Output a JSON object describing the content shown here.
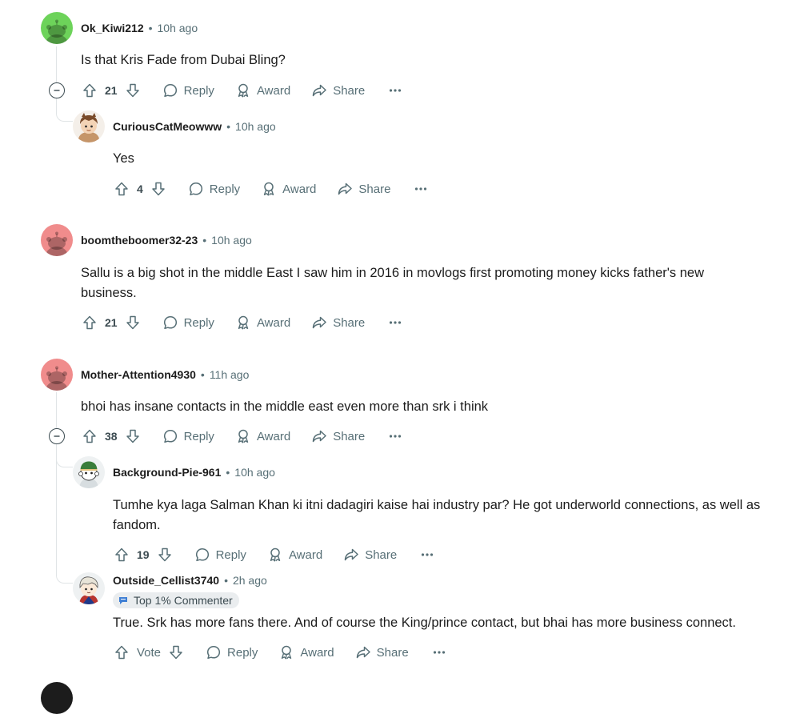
{
  "comments": [
    {
      "username": "Ok_Kiwi212",
      "time": "10h ago",
      "text": "Is that Kris Fade from Dubai Bling?",
      "votes": "21",
      "avatar_color": "#6dd35a"
    },
    {
      "username": "CuriousCatMeowww",
      "time": "10h ago",
      "text": "Yes",
      "votes": "4"
    },
    {
      "username": "boomtheboomer32-23",
      "time": "10h ago",
      "text": "Sallu is a big shot in the middle East I saw him in 2016 in movlogs first promoting money kicks father's new business.",
      "votes": "21",
      "avatar_color": "#f08c8c"
    },
    {
      "username": "Mother-Attention4930",
      "time": "11h ago",
      "text": "bhoi has insane contacts in the middle east even more than srk i think",
      "votes": "38",
      "avatar_color": "#f08c8c"
    },
    {
      "username": "Background-Pie-961",
      "time": "10h ago",
      "text": "Tumhe kya laga Salman Khan ki itni dadagiri kaise hai industry par? He got underworld connections, as well as fandom.",
      "votes": "19"
    },
    {
      "username": "Outside_Cellist3740",
      "time": "2h ago",
      "flair": "Top 1% Commenter",
      "text": "True. Srk has more fans there. And of course the King/prince contact, but bhai has more business connect.",
      "votes": "Vote"
    }
  ],
  "labels": {
    "reply": "Reply",
    "award": "Award",
    "share": "Share",
    "separator": "•"
  }
}
